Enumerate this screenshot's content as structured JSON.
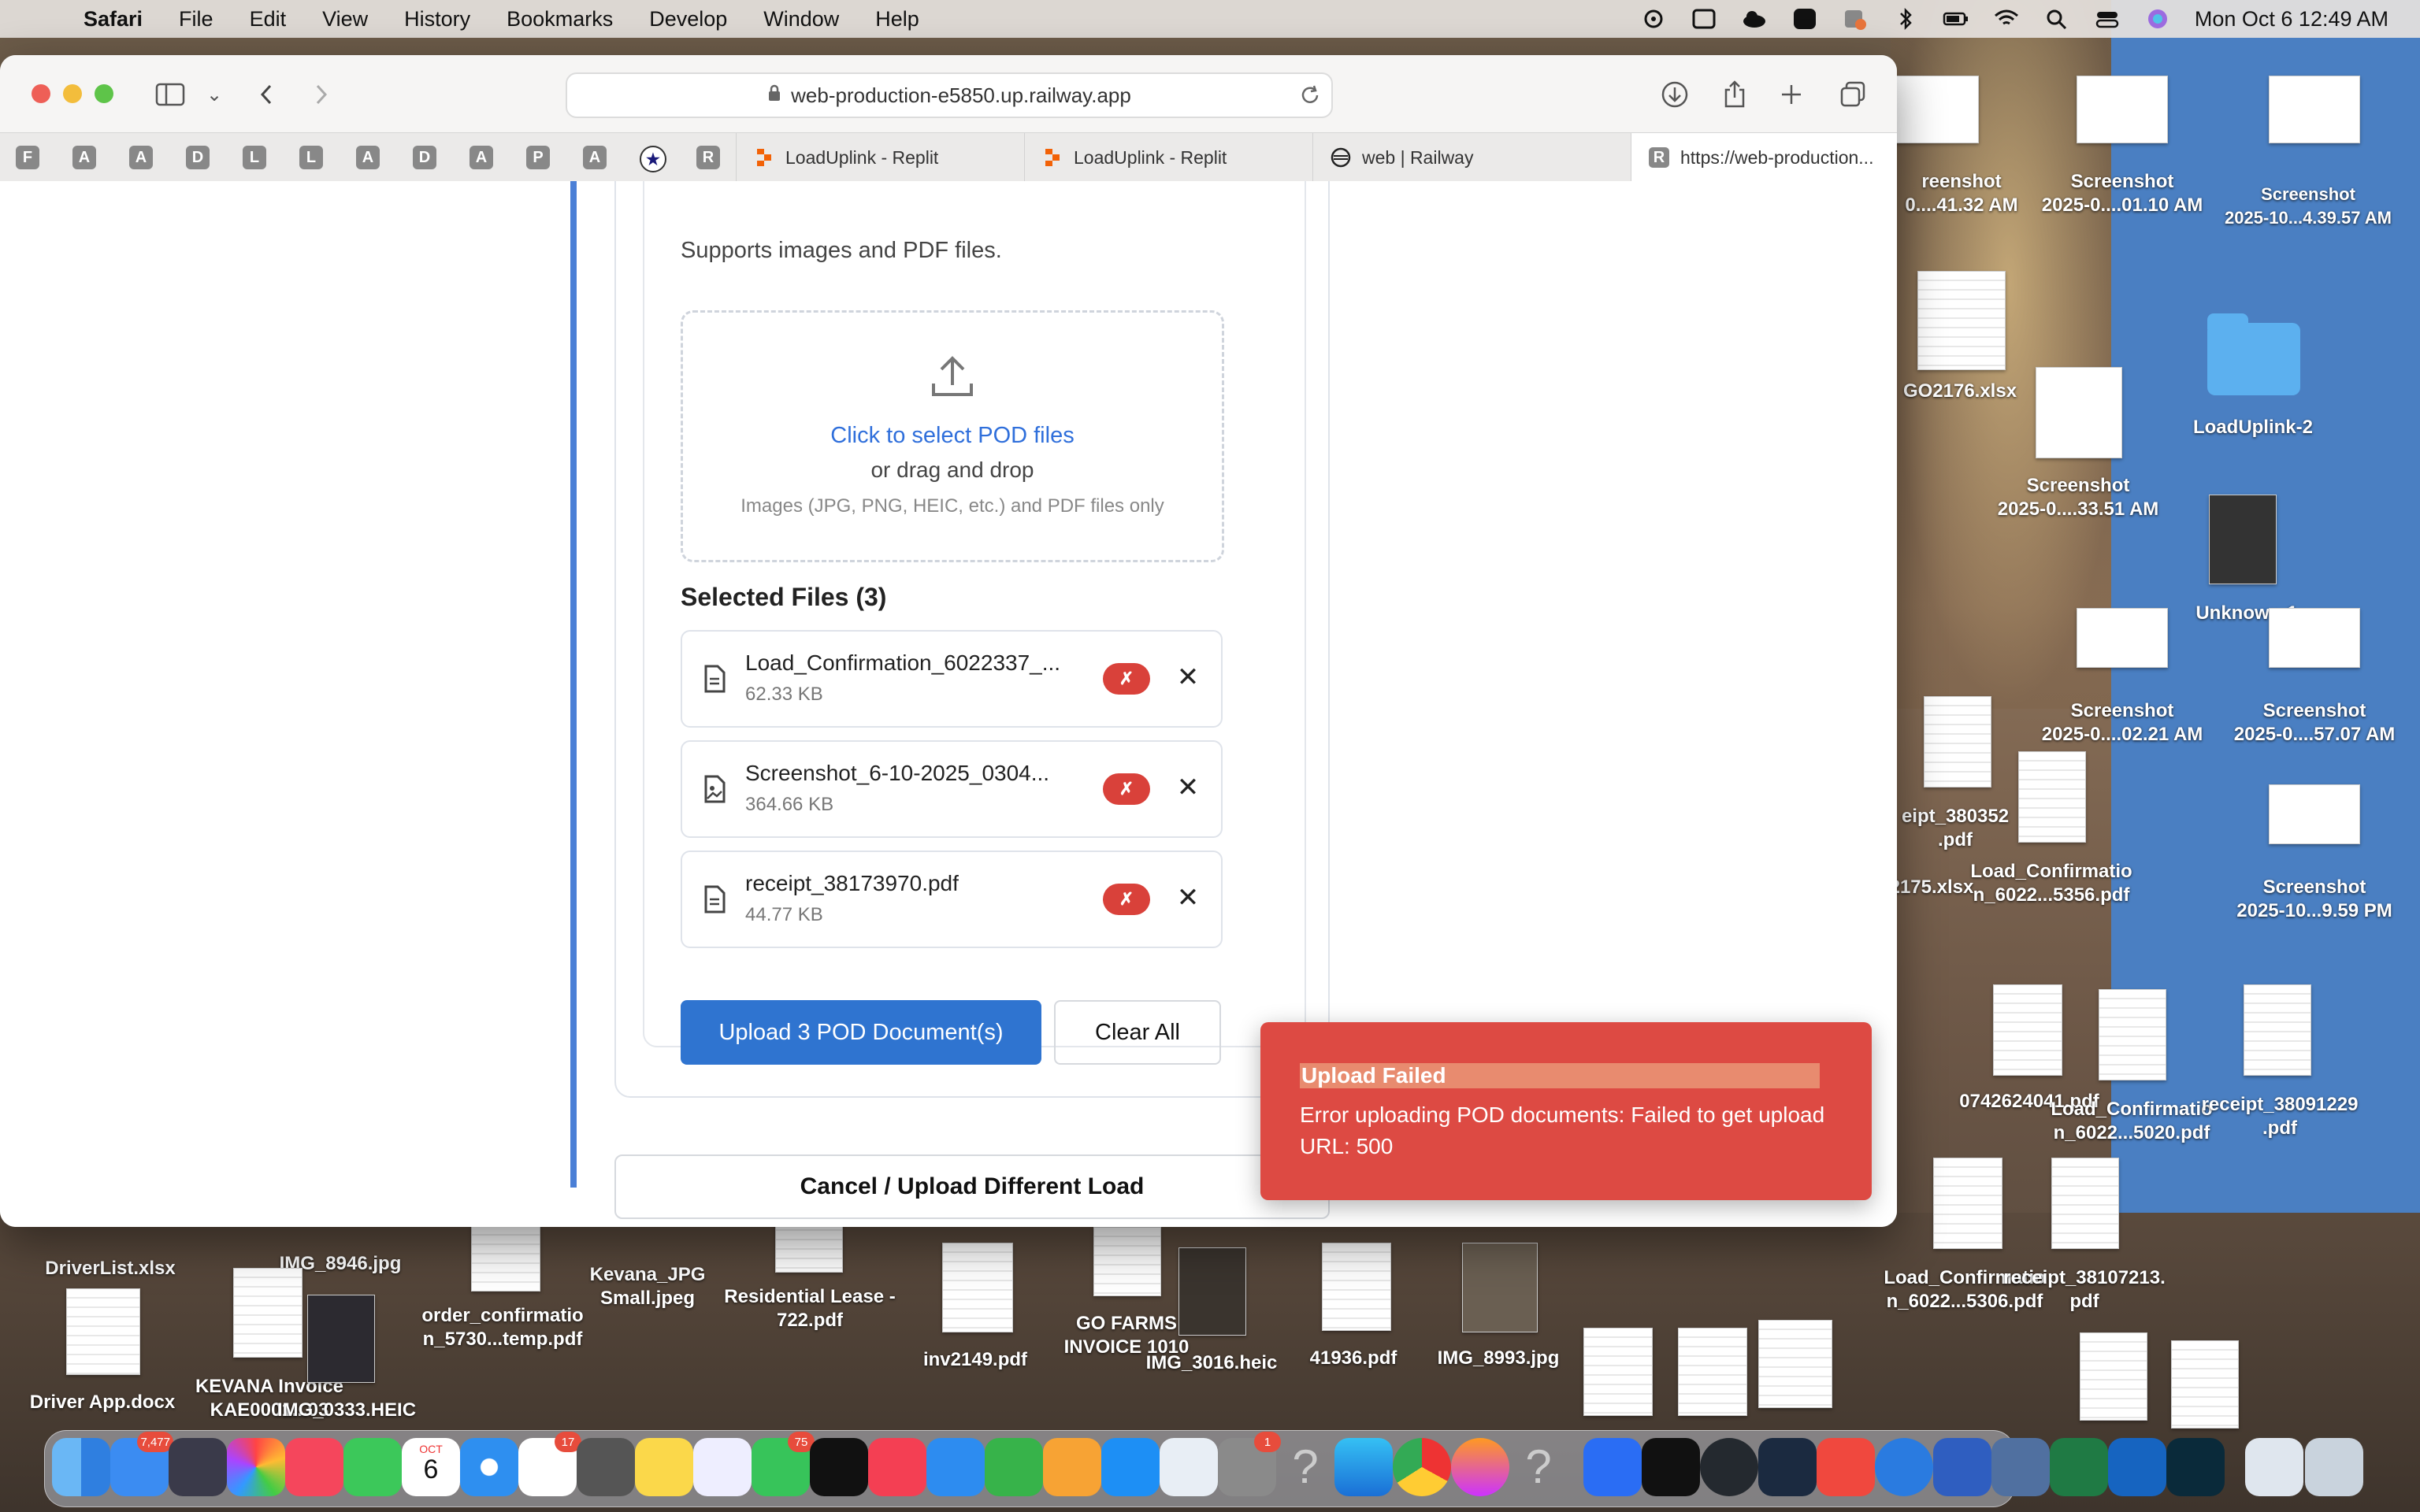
{
  "menubar": {
    "app": "Safari",
    "items": [
      "File",
      "Edit",
      "View",
      "History",
      "Bookmarks",
      "Develop",
      "Window",
      "Help"
    ],
    "clock": "Mon Oct 6  12:49 AM"
  },
  "browser": {
    "url": "web-production-e5850.up.railway.app",
    "favorites": [
      "F",
      "A",
      "A",
      "D",
      "L",
      "L",
      "A",
      "D",
      "A",
      "P",
      "A",
      "★",
      "R"
    ],
    "tabs": [
      {
        "icon": "replit-icon",
        "label": "LoadUplink - Replit"
      },
      {
        "icon": "replit-icon",
        "label": "LoadUplink - Replit"
      },
      {
        "icon": "railway-icon",
        "label": "web | Railway"
      },
      {
        "icon": "r-icon",
        "label": "https://web-production..."
      }
    ]
  },
  "uploader": {
    "supports": "Supports images and PDF files.",
    "dropzone": {
      "title": "Click to select POD files",
      "subtitle": "or drag and drop",
      "hint": "Images (JPG, PNG, HEIC, etc.) and PDF files only"
    },
    "selected_heading": "Selected Files (3)",
    "files": [
      {
        "name": "Load_Confirmation_6022337_...",
        "size": "62.33 KB",
        "status": "✗"
      },
      {
        "name": "Screenshot_6-10-2025_0304...",
        "size": "364.66 KB",
        "status": "✗"
      },
      {
        "name": "receipt_38173970.pdf",
        "size": "44.77 KB",
        "status": "✗"
      }
    ],
    "upload_label": "Upload 3 POD Document(s)",
    "clear_label": "Clear All",
    "cancel_label": "Cancel / Upload Different Load"
  },
  "toast": {
    "title": "Upload Failed",
    "message": "Error uploading POD documents: Failed to get upload URL: 500"
  },
  "desktop": {
    "icons": [
      "reenshot\n0....41.32 AM",
      "Screenshot\n2025-0....01.10 AM",
      "Screenshot\n2025-10...4.39.57 AM",
      "GO2176.xlsx",
      "LoadUplink-2",
      "Screenshot\n2025-0....33.51 AM",
      "Unknown-1",
      "Screenshot\n2025-0....02.21 AM",
      "Screenshot\n2025-0....57.07 AM",
      "eipt_380352\n.pdf",
      "2175.xlsx",
      "Load_Confirmatio\nn_6022...5356.pdf",
      "Screenshot\n2025-10...9.59 PM",
      "0742624041.pdf",
      "Load_Confirmatio\nn_6022...5020.pdf",
      "receipt_38091229\n.pdf",
      "Load_Confirmatio\nn_6022...5306.pdf",
      "receipt_38107213.\npdf",
      "DriverList.xlsx",
      "IMG_8946.jpg",
      "Kevana_JPG\nSmall.jpeg",
      "Residential Lease -\n722.pdf",
      "order_confirmatio\nn_5730...temp.pdf",
      "GO FARMS\nINVOICE 1010",
      "inv2149.pdf",
      "IMG_3016.heic",
      "41936.pdf",
      "IMG_8993.jpg",
      "Driver App.docx",
      "KEVANA Invoice\nKAE0001...03",
      "IMG_0333.HEIC"
    ]
  },
  "dock": {
    "mail_badge": "7,477",
    "reminders_badge": "17",
    "messages_badge": "75",
    "settings_badge": "1",
    "calendar_month": "OCT",
    "calendar_day": "6"
  }
}
